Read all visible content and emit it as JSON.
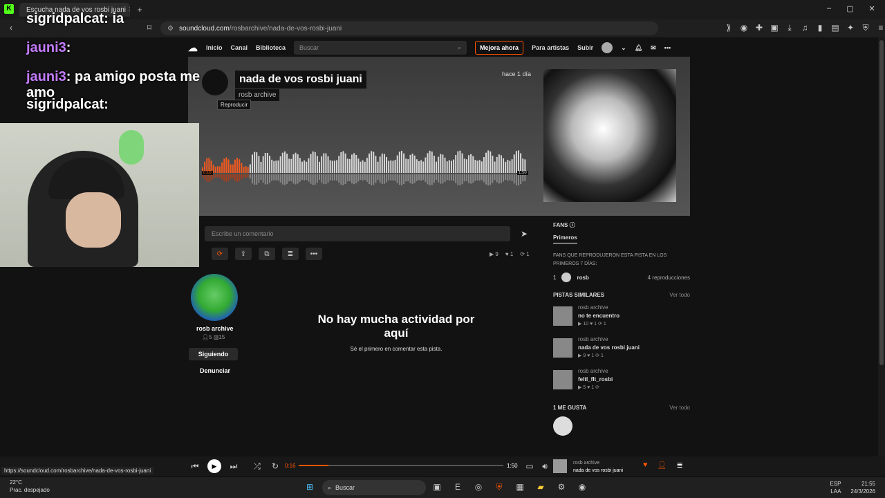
{
  "browser": {
    "tab_title": "Escucha nada de vos rosbi juani",
    "url_domain": "soundcloud.com",
    "url_path": "/rosbarchive/nada-de-vos-rosbi-juani",
    "status_url": "https://soundcloud.com/rosbarchive/nada-de-vos-rosbi-juani"
  },
  "nav": {
    "home": "Inicio",
    "feed": "Canal",
    "library": "Biblioteca",
    "search_placeholder": "Buscar",
    "upgrade": "Mejora ahora",
    "artists": "Para artistas",
    "upload": "Subir"
  },
  "track": {
    "title": "nada de vos rosbi juani",
    "artist": "rosb archive",
    "posted": "hace 1 día",
    "tooltip": "Reproducir",
    "time_current": "0:16",
    "time_total": "1:50",
    "played_fraction": 0.145
  },
  "comment": {
    "placeholder": "Escribe un comentario"
  },
  "stats": {
    "plays": "9",
    "likes": "1",
    "reposts": "1"
  },
  "uploader": {
    "name": "rosb archive",
    "followers": "5",
    "tracks": "15",
    "follow_label": "Siguiendo",
    "report_label": "Denunciar"
  },
  "empty": {
    "heading": "No hay mucha actividad por aquí",
    "sub": "Sé el primero en comentar esta pista."
  },
  "fans": {
    "heading": "FANS",
    "tab": "Primeros",
    "desc": "FANS QUE REPRODUJERON ESTA PISTA EN LOS PRIMEROS 7 DÍAS:",
    "rank": "1",
    "user": "rosb",
    "plays": "4 reproducciones"
  },
  "similar": {
    "heading": "PISTAS SIMILARES",
    "see_all": "Ver todo",
    "items": [
      {
        "artist": "rosb archive",
        "title": "no te encuentro",
        "plays": "10",
        "likes": "1",
        "reposts": "1"
      },
      {
        "artist": "rosb archive",
        "title": "nada de vos rosbi juani",
        "plays": "9",
        "likes": "1",
        "reposts": "1"
      },
      {
        "artist": "rosb archive",
        "title": "feltl_flt_rosbi",
        "plays": "5",
        "likes": "1",
        "reposts": ""
      }
    ]
  },
  "likes": {
    "heading": "1 ME GUSTA",
    "see_all": "Ver todo"
  },
  "player": {
    "time_current": "0:16",
    "time_total": "1:50",
    "artist": "rosb archive",
    "title": "nada de vos rosbi juani"
  },
  "taskbar": {
    "search": "Buscar",
    "temp": "22°C",
    "weather": "Prac. despejado",
    "lang": "ESP",
    "lang2": "LAA",
    "time": "21:55",
    "date": "24/3/2026"
  },
  "chat": [
    {
      "user": "sigridpalcat",
      "text": ": ia"
    },
    {
      "user": "jauni3",
      "text": ":"
    },
    {
      "user": "jauni3",
      "text": ": pa amigo posta me amo"
    },
    {
      "user": "sigridpalcat",
      "text": ":"
    }
  ]
}
